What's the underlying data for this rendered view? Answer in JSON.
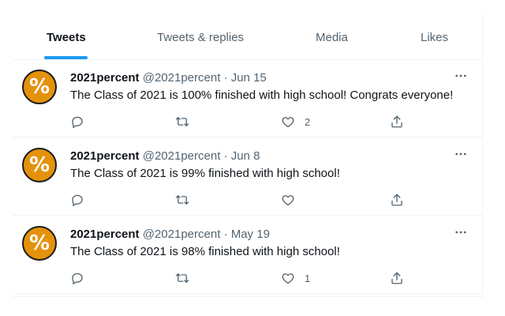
{
  "tabs": [
    {
      "label": "Tweets",
      "active": true
    },
    {
      "label": "Tweets & replies",
      "active": false
    },
    {
      "label": "Media",
      "active": false
    },
    {
      "label": "Likes",
      "active": false
    }
  ],
  "tweets": [
    {
      "avatar_symbol": "%",
      "name": "2021percent",
      "handle": "@2021percent",
      "separator": "·",
      "date": "Jun 15",
      "text": "The Class of 2021 is 100% finished with high school! Congrats everyone!",
      "like_count": "2"
    },
    {
      "avatar_symbol": "%",
      "name": "2021percent",
      "handle": "@2021percent",
      "separator": "·",
      "date": "Jun 8",
      "text": "The Class of 2021 is 99% finished with high school!",
      "like_count": ""
    },
    {
      "avatar_symbol": "%",
      "name": "2021percent",
      "handle": "@2021percent",
      "separator": "·",
      "date": "May 19",
      "text": "The Class of 2021 is 98% finished with high school!",
      "like_count": "1"
    }
  ],
  "colors": {
    "accent": "#1d9bf0",
    "avatar": "#e4920c",
    "secondary_text": "#536471"
  },
  "icons": [
    "reply-icon",
    "retweet-icon",
    "like-icon",
    "share-icon",
    "more-icon"
  ]
}
